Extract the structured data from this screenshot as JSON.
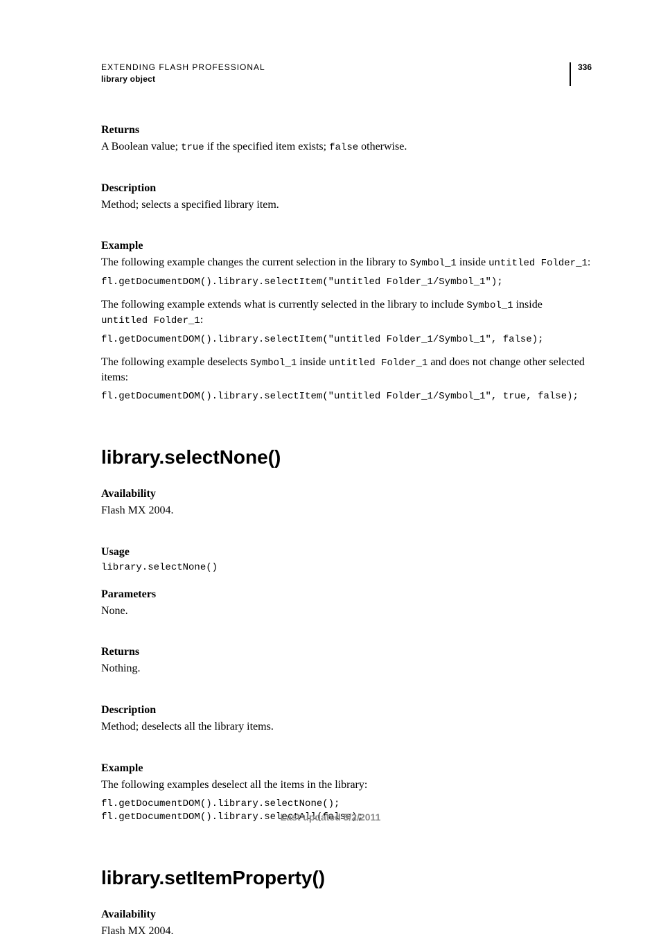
{
  "header": {
    "line1": "EXTENDING FLASH PROFESSIONAL",
    "line2": "library object",
    "page_number": "336"
  },
  "sec1": {
    "returns_label": "Returns",
    "returns_text_pre": "A Boolean value; ",
    "returns_code1": "true",
    "returns_text_mid": " if the specified item exists; ",
    "returns_code2": "false",
    "returns_text_post": " otherwise.",
    "desc_label": "Description",
    "desc_text": "Method; selects a specified library item.",
    "example_label": "Example",
    "ex1_pre": "The following example changes the current selection in the library to ",
    "ex1_c1": "Symbol_1",
    "ex1_mid": " inside ",
    "ex1_c2": "untitled Folder_1",
    "ex1_post": ":",
    "code1": "fl.getDocumentDOM().library.selectItem(\"untitled Folder_1/Symbol_1\");",
    "ex2_pre": "The following example extends what is currently selected in the library to include ",
    "ex2_c1": "Symbol_1",
    "ex2_mid": " inside ",
    "ex2_c2": "untitled Folder_1",
    "ex2_post": ":",
    "code2": "fl.getDocumentDOM().library.selectItem(\"untitled Folder_1/Symbol_1\", false);",
    "ex3_pre": "The following example deselects ",
    "ex3_c1": "Symbol_1",
    "ex3_mid": " inside ",
    "ex3_c2": "untitled Folder_1",
    "ex3_post": " and does not change other selected items:",
    "code3": "fl.getDocumentDOM().library.selectItem(\"untitled Folder_1/Symbol_1\", true, false);"
  },
  "sec2": {
    "heading": "library.selectNone()",
    "avail_label": "Availability",
    "avail_text": "Flash MX 2004.",
    "usage_label": "Usage",
    "usage_code": "library.selectNone()",
    "params_label": "Parameters",
    "params_text": "None.",
    "returns_label": "Returns",
    "returns_text": "Nothing.",
    "desc_label": "Description",
    "desc_text": "Method; deselects all the library items.",
    "example_label": "Example",
    "example_text": "The following examples deselect all the items in the library:",
    "code": "fl.getDocumentDOM().library.selectNone();\nfl.getDocumentDOM().library.selectAll(false);"
  },
  "sec3": {
    "heading": "library.setItemProperty()",
    "avail_label": "Availability",
    "avail_text": "Flash MX 2004."
  },
  "footer": "Last updated 5/2/2011"
}
